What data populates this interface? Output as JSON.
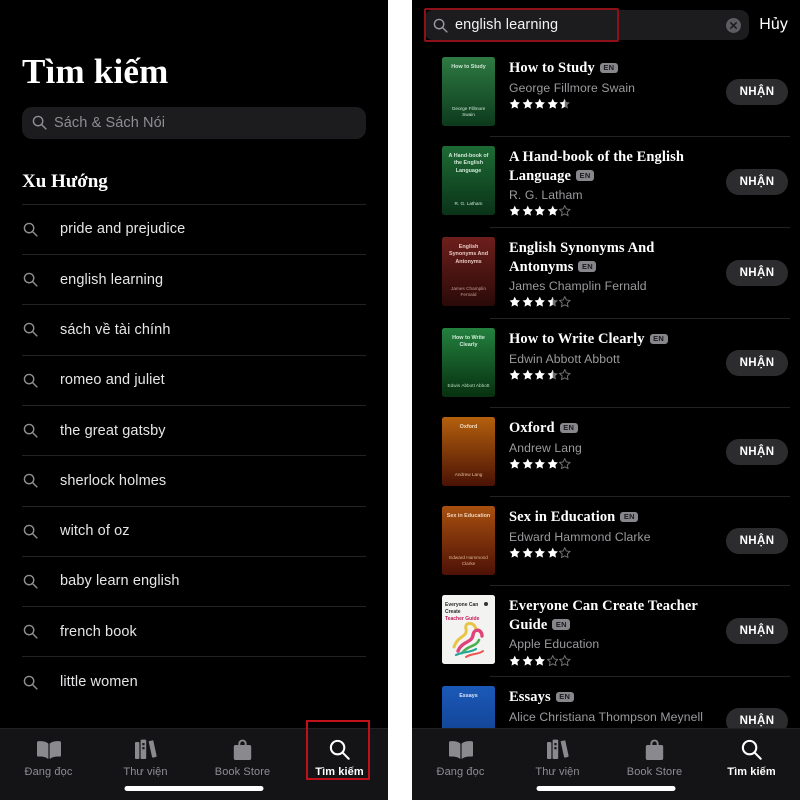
{
  "left_panel": {
    "page_title": "Tìm kiếm",
    "search": {
      "placeholder": "Sách & Sách Nói",
      "icon": "search-icon"
    },
    "trending_heading": "Xu Hướng",
    "trending": [
      "pride and prejudice",
      "english learning",
      "sách về tài chính",
      "romeo and juliet",
      "the great gatsby",
      "sherlock holmes",
      "witch of oz",
      "baby learn english",
      "french book",
      "little women"
    ]
  },
  "right_panel": {
    "search": {
      "value": "english learning",
      "icon": "search-icon",
      "clear_icon": "clear-circle-icon"
    },
    "cancel_label": "Hủy",
    "results": [
      {
        "title": "How to Study",
        "lang_badge": "EN",
        "author": "George Fillmore Swain",
        "rating": 4.5,
        "get_label": "NHẬN",
        "cover": {
          "top": "How to Study",
          "bottom": "George Fillmore Swain",
          "c1": "#2f7a43",
          "c2": "#0c3a1c",
          "text": "#cfe6d6"
        }
      },
      {
        "title": "A Hand-book of the English Language",
        "lang_badge": "EN",
        "author": "R. G. Latham",
        "rating": 4,
        "get_label": "NHẬN",
        "cover": {
          "top": "A Hand-book of the English Language",
          "bottom": "R. G. Latham",
          "c1": "#1e6b35",
          "c2": "#0a3318",
          "text": "#cfe6d6"
        }
      },
      {
        "title": "English Synonyms And Antonyms",
        "lang_badge": "EN",
        "author": "James Champlin Fernald",
        "rating": 3.5,
        "get_label": "NHẬN",
        "cover": {
          "top": "English Synonyms And Antonyms",
          "bottom": "James Champlin Fernald",
          "c1": "#6d1f1c",
          "c2": "#2a0a08",
          "text": "#e8c9c4"
        }
      },
      {
        "title": "How to Write Clearly",
        "lang_badge": "EN",
        "author": "Edwin Abbott Abbott",
        "rating": 3.5,
        "get_label": "NHẬN",
        "cover": {
          "top": "How to Write Clearly",
          "bottom": "Edwin Abbott Abbott",
          "c1": "#23813f",
          "c2": "#07300f",
          "text": "#d2ecd8"
        }
      },
      {
        "title": "Oxford",
        "lang_badge": "EN",
        "author": "Andrew Lang",
        "rating": 4,
        "get_label": "NHẬN",
        "cover": {
          "top": "Oxford",
          "bottom": "Andrew Lang",
          "c1": "#b4600d",
          "c2": "#4a1205",
          "text": "#f4dcc2"
        }
      },
      {
        "title": "Sex in Education",
        "lang_badge": "EN",
        "author": "Edward Hammond Clarke",
        "rating": 4,
        "get_label": "NHẬN",
        "cover": {
          "top": "Sex in Education",
          "bottom": "Edward Hammond Clarke",
          "c1": "#a8500f",
          "c2": "#4d1106",
          "text": "#f2d6bc"
        }
      },
      {
        "title": "Everyone Can Create Teacher Guide",
        "lang_badge": "EN",
        "author": "Apple Education",
        "rating": 3,
        "get_label": "NHẬN",
        "cover": {
          "top": "Everyone Can Create",
          "bottom": "",
          "c1": "#f3f3f1",
          "c2": "#e9e9e6",
          "text": "#2b2b2b"
        }
      },
      {
        "title": "Essays",
        "lang_badge": "EN",
        "author": "Alice Christiana Thompson Meynell",
        "rating": null,
        "get_label": "NHẬN",
        "cover": {
          "top": "Essays",
          "bottom": "",
          "c1": "#1b59b8",
          "c2": "#0e3b86",
          "text": "#dbe7fa"
        }
      }
    ]
  },
  "tabbar": {
    "items": [
      {
        "label": "Đang đọc",
        "icon": "open-book-icon",
        "active": false
      },
      {
        "label": "Thư viện",
        "icon": "bookshelf-icon",
        "active": false
      },
      {
        "label": "Book Store",
        "icon": "shopping-bag-icon",
        "active": false
      },
      {
        "label": "Tìm kiếm",
        "icon": "search-icon",
        "active": true
      }
    ]
  },
  "colors": {
    "highlight": "#c0101a",
    "accent_badge": "#86868b",
    "background": "#000000"
  }
}
